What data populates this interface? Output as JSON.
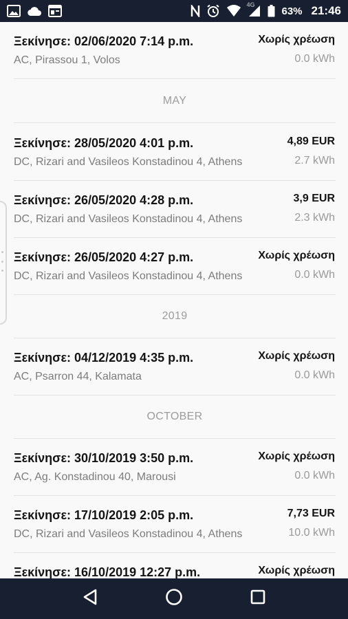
{
  "status_bar": {
    "battery_percent": "63%",
    "network": "4G",
    "time": "21:46",
    "left_icons": [
      "image-icon",
      "cloud-icon",
      "calendar-app-icon"
    ],
    "right_icons": [
      "nfc-icon",
      "alarm-icon",
      "wifi-icon",
      "signal-icon",
      "battery-icon"
    ]
  },
  "sessions": [
    {
      "title": "Ξεκίνησε: 02/06/2020 7:14 p.m.",
      "location": "AC, Pirassou 1, Volos",
      "price": "Χωρίς χρέωση",
      "energy": "0.0 kWh"
    },
    {
      "section": "MAY"
    },
    {
      "title": "Ξεκίνησε: 28/05/2020 4:01 p.m.",
      "location": "DC, Rizari and Vasileos Konstadinou 4, Athens",
      "price": "4,89 EUR",
      "energy": "2.7 kWh"
    },
    {
      "title": "Ξεκίνησε: 26/05/2020 4:28 p.m.",
      "location": "DC, Rizari and Vasileos Konstadinou 4, Athens",
      "price": "3,9 EUR",
      "energy": "2.3 kWh"
    },
    {
      "title": "Ξεκίνησε: 26/05/2020 4:27 p.m.",
      "location": "DC, Rizari and Vasileos Konstadinou 4, Athens",
      "price": "Χωρίς χρέωση",
      "energy": "0.0 kWh"
    },
    {
      "section": "2019"
    },
    {
      "title": "Ξεκίνησε: 04/12/2019 4:35 p.m.",
      "location": "AC, Psarron 44, Kalamata",
      "price": "Χωρίς χρέωση",
      "energy": "0.0 kWh"
    },
    {
      "section": "OCTOBER"
    },
    {
      "title": "Ξεκίνησε: 30/10/2019 3:50 p.m.",
      "location": "AC, Ag. Konstadinou 40, Marousi",
      "price": "Χωρίς χρέωση",
      "energy": "0.0 kWh"
    },
    {
      "title": "Ξεκίνησε: 17/10/2019 2:05 p.m.",
      "location": "DC, Rizari and Vasileos Konstadinou 4, Athens",
      "price": "7,73 EUR",
      "energy": "10.0 kWh"
    },
    {
      "title": "Ξεκίνησε: 16/10/2019 12:27 p.m.",
      "location": "",
      "price": "Χωρίς χρέωση",
      "energy": ""
    }
  ],
  "nav_bar": {
    "buttons": [
      "back-icon",
      "home-icon",
      "recents-icon"
    ]
  }
}
